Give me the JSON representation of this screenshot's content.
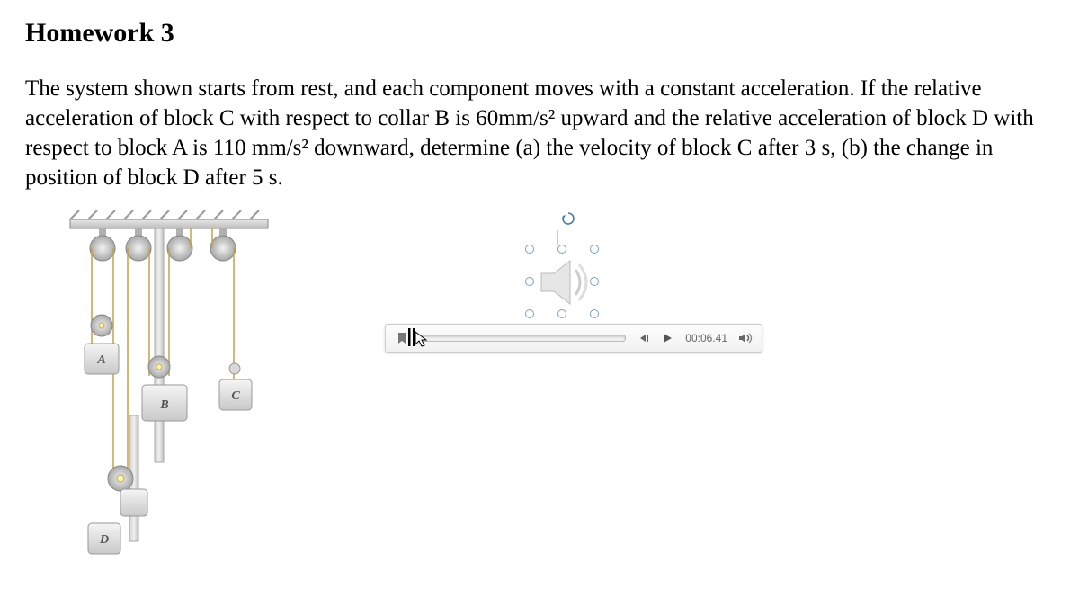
{
  "title": "Homework 3",
  "problem": "The system shown starts from rest, and each component moves with a constant acceleration. If the relative acceleration of block C with respect to collar B is 60mm/s² upward and the relative acceleration of block D with respect to block A is 110 mm/s² downward, determine (a) the velocity of block C after 3 s, (b) the change in position of block D after 5 s.",
  "diagram": {
    "labels": {
      "A": "A",
      "B": "B",
      "C": "C",
      "D": "D"
    }
  },
  "media": {
    "time": "00:06.41"
  }
}
